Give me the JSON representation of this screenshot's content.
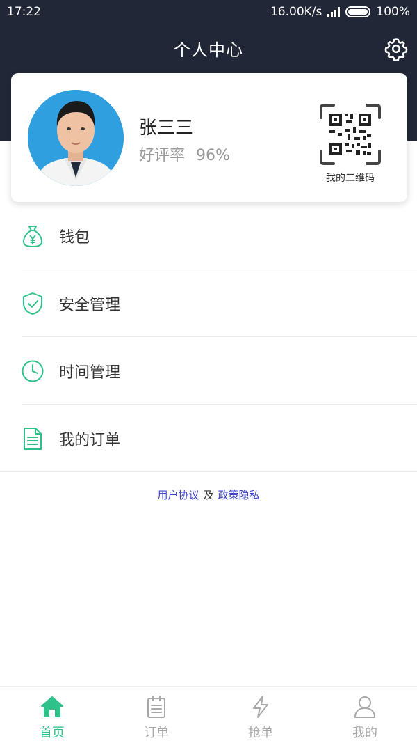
{
  "status_bar": {
    "time": "17:22",
    "network_speed": "16.00K/s",
    "battery": "100%"
  },
  "header": {
    "title": "个人中心",
    "settings_icon": "gear-icon"
  },
  "profile": {
    "name": "张三三",
    "rating_label": "好评率",
    "rating_value": "96%",
    "qr_caption": "我的二维码"
  },
  "menu": {
    "items": [
      {
        "label": "钱包",
        "icon": "money-bag-icon"
      },
      {
        "label": "安全管理",
        "icon": "shield-check-icon"
      },
      {
        "label": "时间管理",
        "icon": "clock-icon"
      },
      {
        "label": "我的订单",
        "icon": "document-icon"
      }
    ]
  },
  "policy": {
    "user_agreement": "用户协议",
    "and": "及",
    "privacy_policy": "政策隐私"
  },
  "tabs": [
    {
      "label": "首页",
      "icon": "home-icon",
      "active": true
    },
    {
      "label": "订单",
      "icon": "clipboard-icon",
      "active": false
    },
    {
      "label": "抢单",
      "icon": "lightning-icon",
      "active": false
    },
    {
      "label": "我的",
      "icon": "user-icon",
      "active": false
    }
  ],
  "colors": {
    "header_bg": "#222738",
    "accent_green": "#2ec28a",
    "link_blue": "#3d46c9",
    "tab_inactive": "#a8a8a8"
  }
}
